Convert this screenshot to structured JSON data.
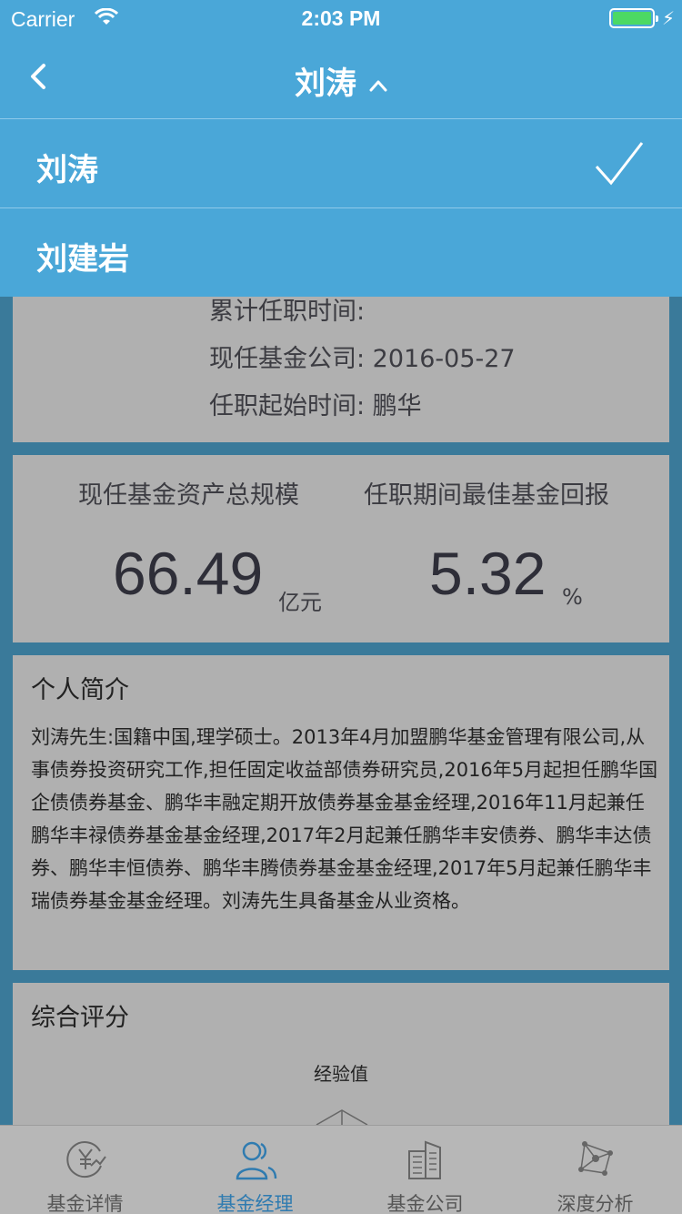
{
  "status_bar": {
    "carrier": "Carrier",
    "time": "2:03 PM"
  },
  "nav": {
    "title": "刘涛",
    "back_icon": "chevron-left-icon",
    "toggle_icon": "chevron-up-icon"
  },
  "dropdown": {
    "items": [
      {
        "label": "刘涛",
        "selected": true
      },
      {
        "label": "刘建岩",
        "selected": false
      }
    ]
  },
  "info": {
    "cumulative_label": "累计任职时间:",
    "row1": "现任基金公司: 2016-05-27",
    "row2": "任职起始时间: 鹏华"
  },
  "stats": {
    "left": {
      "label": "现任基金资产总规模",
      "value": "66.49",
      "unit": "亿元"
    },
    "right": {
      "label": "任职期间最佳基金回报",
      "value": "5.32",
      "unit": "%"
    }
  },
  "profile": {
    "title": "个人简介",
    "text": "刘涛先生:国籍中国,理学硕士。2013年4月加盟鹏华基金管理有限公司,从事债券投资研究工作,担任固定收益部债券研究员,2016年5月起担任鹏华国企债债券基金、鹏华丰融定期开放债券基金基金经理,2016年11月起兼任鹏华丰禄债券基金基金经理,2017年2月起兼任鹏华丰安债券、鹏华丰达债券、鹏华丰恒债券、鹏华丰腾债券基金基金经理,2017年5月起兼任鹏华丰瑞债券基金基金经理。刘涛先生具备基金从业资格。"
  },
  "rating": {
    "title": "综合评分",
    "axis_top": "经验值"
  },
  "tabs": [
    {
      "label": "基金详情",
      "icon": "yen-chart-icon",
      "active": false
    },
    {
      "label": "基金经理",
      "icon": "people-icon",
      "active": true
    },
    {
      "label": "基金公司",
      "icon": "building-icon",
      "active": false
    },
    {
      "label": "深度分析",
      "icon": "network-icon",
      "active": false
    }
  ],
  "colors": {
    "nav": "#4aa7d8",
    "active_tab": "#2f7bb0",
    "battery": "#4cd964"
  }
}
